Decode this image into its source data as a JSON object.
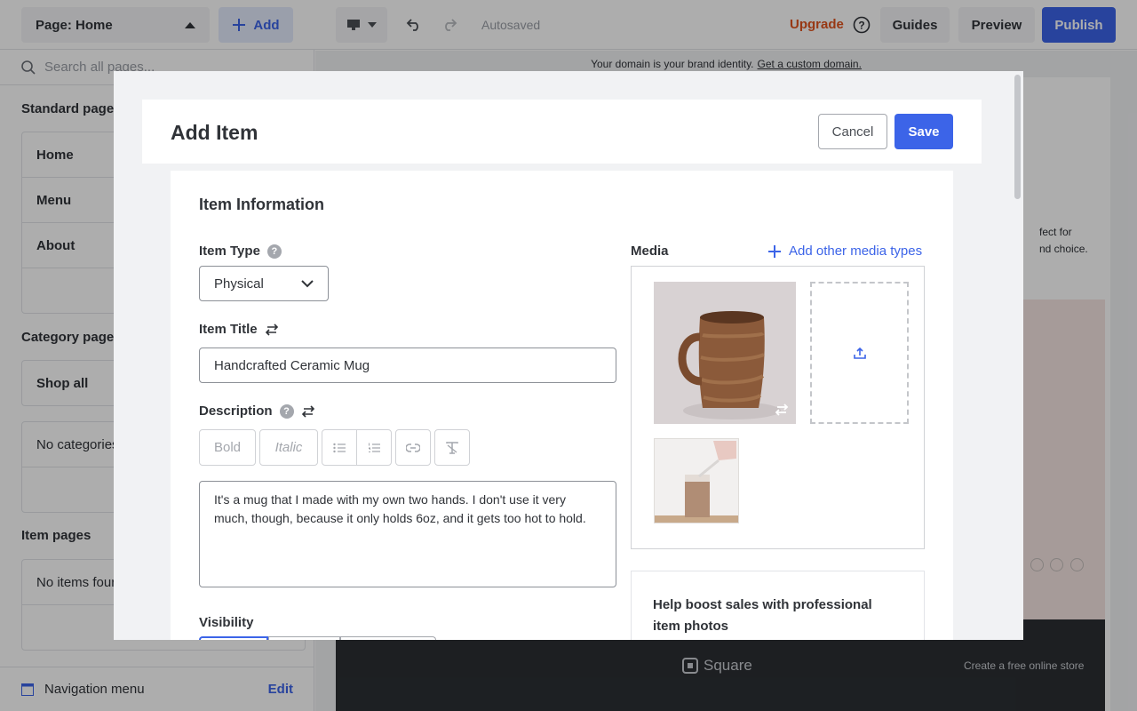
{
  "topbar": {
    "page_select": "Page: Home",
    "add_label": "Add",
    "autosaved": "Autosaved",
    "upgrade": "Upgrade",
    "guides": "Guides",
    "preview": "Preview",
    "publish": "Publish"
  },
  "sidebar": {
    "search_placeholder": "Search all pages...",
    "standard_heading": "Standard pages",
    "standard_items": [
      "Home",
      "Menu",
      "About"
    ],
    "category_heading": "Category pages",
    "category_items": [
      "Shop all",
      "No categories"
    ],
    "item_heading": "Item pages",
    "item_empty": "No items four",
    "nav_menu": "Navigation menu",
    "nav_edit": "Edit"
  },
  "preview": {
    "domain_text": "Your domain is your brand identity.",
    "domain_link": "Get a custom domain.",
    "hero_line1": "fect for",
    "hero_line2": "nd choice.",
    "square_brand": "Square",
    "free_store": "Create a free online store"
  },
  "modal": {
    "title": "Add Item",
    "cancel": "Cancel",
    "save": "Save",
    "section_title": "Item Information",
    "item_type_label": "Item Type",
    "item_type_value": "Physical",
    "item_title_label": "Item Title",
    "item_title_value": "Handcrafted Ceramic Mug",
    "description_label": "Description",
    "toolbar_bold": "Bold",
    "toolbar_italic": "Italic",
    "description_value": "It's a mug that I made with my own two hands. I don't use it very much, though, because it only holds 6oz, and it gets too hot to hold.",
    "visibility_label": "Visibility",
    "media_label": "Media",
    "add_media": "Add other media types",
    "boost_text": "Help boost sales with professional item photos"
  },
  "colors": {
    "accent": "#3c64e8",
    "upgrade": "#e0531e",
    "text": "#303338"
  }
}
